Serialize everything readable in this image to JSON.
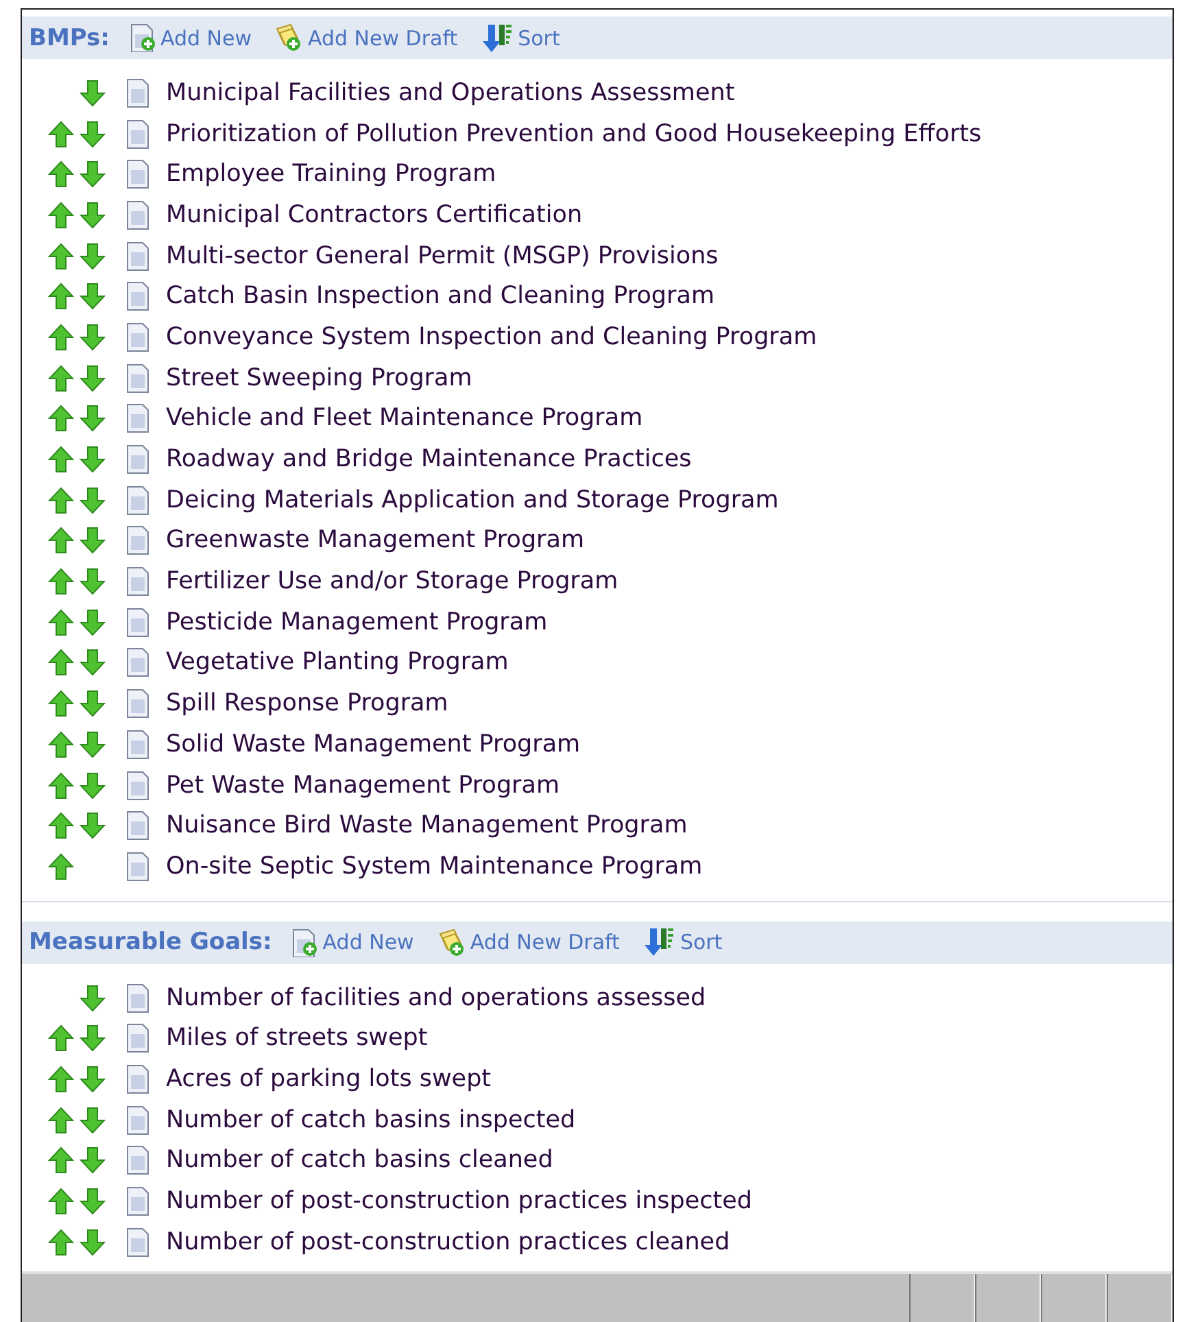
{
  "sections": [
    {
      "title": "BMPs:",
      "actions": [
        {
          "kind": "add",
          "label": "Add New"
        },
        {
          "kind": "draft",
          "label": "Add New Draft"
        },
        {
          "kind": "sort",
          "label": "Sort"
        }
      ],
      "items": [
        {
          "label": "Municipal Facilities and Operations Assessment",
          "can_move_up": false,
          "can_move_down": true
        },
        {
          "label": "Prioritization of Pollution Prevention and Good Housekeeping Efforts",
          "can_move_up": true,
          "can_move_down": true
        },
        {
          "label": "Employee Training Program",
          "can_move_up": true,
          "can_move_down": true
        },
        {
          "label": "Municipal Contractors Certification",
          "can_move_up": true,
          "can_move_down": true
        },
        {
          "label": "Multi-sector General Permit (MSGP) Provisions",
          "can_move_up": true,
          "can_move_down": true
        },
        {
          "label": "Catch Basin Inspection and Cleaning Program",
          "can_move_up": true,
          "can_move_down": true
        },
        {
          "label": "Conveyance System Inspection and Cleaning Program",
          "can_move_up": true,
          "can_move_down": true
        },
        {
          "label": "Street Sweeping Program",
          "can_move_up": true,
          "can_move_down": true
        },
        {
          "label": "Vehicle and Fleet Maintenance Program",
          "can_move_up": true,
          "can_move_down": true
        },
        {
          "label": "Roadway and Bridge Maintenance Practices",
          "can_move_up": true,
          "can_move_down": true
        },
        {
          "label": "Deicing Materials Application and Storage Program",
          "can_move_up": true,
          "can_move_down": true
        },
        {
          "label": "Greenwaste Management Program",
          "can_move_up": true,
          "can_move_down": true
        },
        {
          "label": "Fertilizer Use and/or Storage Program",
          "can_move_up": true,
          "can_move_down": true
        },
        {
          "label": "Pesticide Management Program",
          "can_move_up": true,
          "can_move_down": true
        },
        {
          "label": "Vegetative Planting Program",
          "can_move_up": true,
          "can_move_down": true
        },
        {
          "label": "Spill Response Program",
          "can_move_up": true,
          "can_move_down": true
        },
        {
          "label": "Solid Waste Management Program",
          "can_move_up": true,
          "can_move_down": true
        },
        {
          "label": "Pet Waste Management Program",
          "can_move_up": true,
          "can_move_down": true
        },
        {
          "label": "Nuisance Bird Waste Management Program",
          "can_move_up": true,
          "can_move_down": true
        },
        {
          "label": "On-site Septic System Maintenance Program",
          "can_move_up": true,
          "can_move_down": false
        }
      ]
    },
    {
      "title": "Measurable Goals:",
      "actions": [
        {
          "kind": "add",
          "label": "Add New"
        },
        {
          "kind": "draft",
          "label": "Add New Draft"
        },
        {
          "kind": "sort",
          "label": "Sort"
        }
      ],
      "items": [
        {
          "label": "Number of facilities and operations assessed",
          "can_move_up": false,
          "can_move_down": true
        },
        {
          "label": "Miles of streets swept",
          "can_move_up": true,
          "can_move_down": true
        },
        {
          "label": "Acres of parking lots swept",
          "can_move_up": true,
          "can_move_down": true
        },
        {
          "label": "Number of catch basins inspected",
          "can_move_up": true,
          "can_move_down": true
        },
        {
          "label": "Number of catch basins cleaned",
          "can_move_up": true,
          "can_move_down": true
        },
        {
          "label": "Number of post-construction practices inspected",
          "can_move_up": true,
          "can_move_down": true
        },
        {
          "label": "Number of post-construction practices cleaned",
          "can_move_up": true,
          "can_move_down": true
        }
      ]
    }
  ]
}
